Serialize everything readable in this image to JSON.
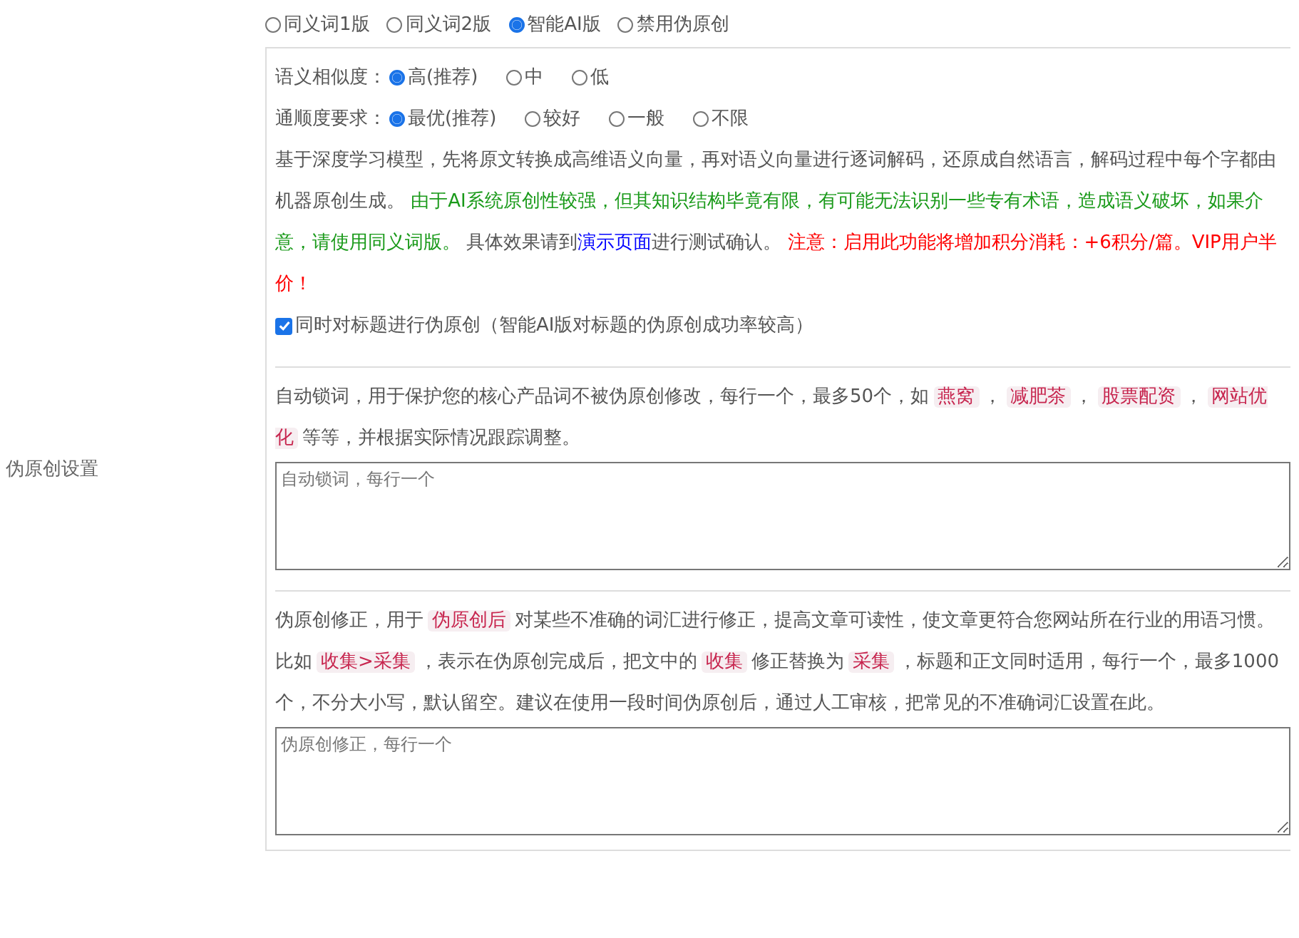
{
  "section_label": "伪原创设置",
  "modes": [
    {
      "label": "同义词1版",
      "selected": false
    },
    {
      "label": "同义词2版",
      "selected": false
    },
    {
      "label": "智能AI版",
      "selected": true
    },
    {
      "label": "禁用伪原创",
      "selected": false
    }
  ],
  "option_groups": [
    {
      "label": "语义相似度：",
      "options": [
        {
          "label": "高(推荐)",
          "selected": true
        },
        {
          "label": "中",
          "selected": false
        },
        {
          "label": "低",
          "selected": false
        }
      ]
    },
    {
      "label": "通顺度要求：",
      "options": [
        {
          "label": "最优(推荐)",
          "selected": true
        },
        {
          "label": "较好",
          "selected": false
        },
        {
          "label": "一般",
          "selected": false
        },
        {
          "label": "不限",
          "selected": false
        }
      ]
    }
  ],
  "ai_description": [
    {
      "kind": "text",
      "text": "基于深度学习模型，先将原文转换成高维语义向量，再对语义向量进行逐词解码，还原成自然语言，解码过程中每个字都由机器原创生成。 "
    },
    {
      "kind": "green",
      "text": "由于AI系统原创性较强，但其知识结构毕竟有限，有可能无法识别一些专有术语，造成语义破坏，如果介意，请使用同义词版。"
    },
    {
      "kind": "text",
      "text": " 具体效果请到"
    },
    {
      "kind": "link",
      "text": "演示页面"
    },
    {
      "kind": "text",
      "text": "进行测试确认。 "
    },
    {
      "kind": "red",
      "text": "注意：启用此功能将增加积分消耗：+6积分/篇。VIP用户半价！"
    }
  ],
  "title_option": {
    "label": "同时对标题进行伪原创（智能AI版对标题的伪原创成功率较高）",
    "checked": true
  },
  "lock_words": {
    "description": [
      {
        "kind": "text",
        "text": "自动锁词，用于保护您的核心产品词不被伪原创修改，每行一个，最多50个，如"
      },
      {
        "kind": "code",
        "text": "燕窝"
      },
      {
        "kind": "text",
        "text": "，"
      },
      {
        "kind": "code",
        "text": "减肥茶"
      },
      {
        "kind": "text",
        "text": "，"
      },
      {
        "kind": "code",
        "text": "股票配资"
      },
      {
        "kind": "text",
        "text": "，"
      },
      {
        "kind": "code",
        "text": "网站优化"
      },
      {
        "kind": "text",
        "text": "等等，并根据实际情况跟踪调整。"
      }
    ],
    "placeholder": "自动锁词，每行一个"
  },
  "corrections": {
    "description": [
      {
        "kind": "text",
        "text": "伪原创修正，用于"
      },
      {
        "kind": "code",
        "text": "伪原创后"
      },
      {
        "kind": "text",
        "text": "对某些不准确的词汇进行修正，提高文章可读性，使文章更符合您网站所在行业的用语习惯。比如"
      },
      {
        "kind": "code",
        "text": "收集>采集"
      },
      {
        "kind": "text",
        "text": "，表示在伪原创完成后，把文中的"
      },
      {
        "kind": "code",
        "text": "收集"
      },
      {
        "kind": "text",
        "text": "修正替换为"
      },
      {
        "kind": "code",
        "text": "采集"
      },
      {
        "kind": "text",
        "text": "，标题和正文同时适用，每行一个，最多1000个，不分大小写，默认留空。建议在使用一段时间伪原创后，通过人工审核，把常见的不准确词汇设置在此。"
      }
    ],
    "placeholder": "伪原创修正，每行一个"
  }
}
